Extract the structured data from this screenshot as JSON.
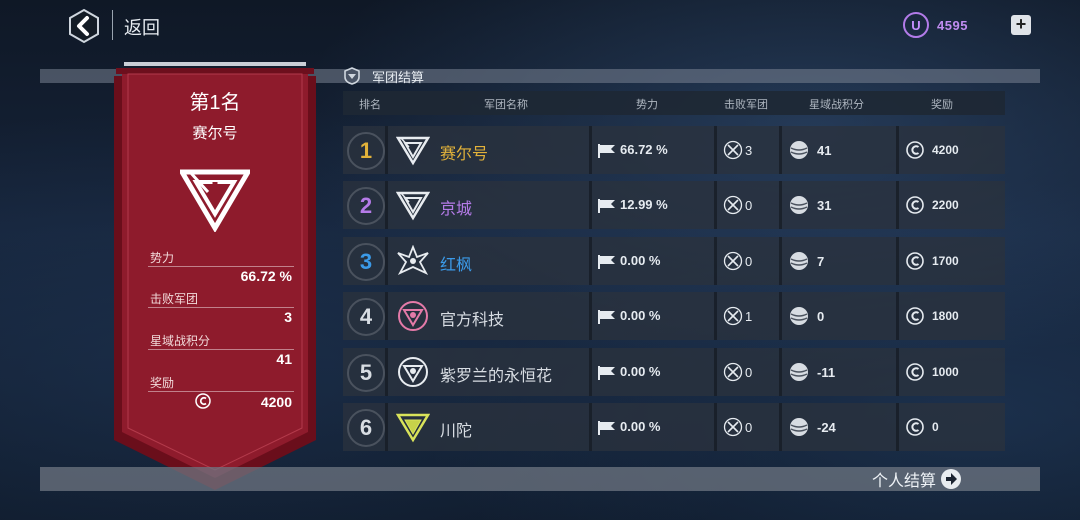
{
  "header": {
    "back_label": "返回",
    "currency": {
      "icon": "u-currency-icon",
      "symbol": "U",
      "value": "4595",
      "color": "#c08cf0"
    },
    "plus_label": "+"
  },
  "banner": {
    "rank_title": "第1名",
    "team_name": "赛尔号",
    "color": "#8e1b2c",
    "stats": [
      {
        "label": "势力",
        "value": "66.72 %"
      },
      {
        "label": "击败军团",
        "value": "3"
      },
      {
        "label": "星域战积分",
        "value": "41"
      },
      {
        "label": "奖励",
        "value": "4200",
        "icon": "coin-icon"
      }
    ]
  },
  "section": {
    "title": "军团结算",
    "headers": [
      "排名",
      "军团名称",
      "势力",
      "击败军团",
      "星域战积分",
      "奖励"
    ]
  },
  "rows": [
    {
      "rank": "1",
      "name": "赛尔号",
      "power": "66.72 %",
      "defeated": "3",
      "score": "41",
      "reward": "4200",
      "rank_color": "#e2b23a",
      "name_color": "#e2b23a"
    },
    {
      "rank": "2",
      "name": "京城",
      "power": "12.99 %",
      "defeated": "0",
      "score": "31",
      "reward": "2200",
      "rank_color": "#b57be8",
      "name_color": "#b57be8"
    },
    {
      "rank": "3",
      "name": "红枫",
      "power": "0.00 %",
      "defeated": "0",
      "score": "7",
      "reward": "1700",
      "rank_color": "#3b9ae8",
      "name_color": "#3b9ae8"
    },
    {
      "rank": "4",
      "name": "官方科技",
      "power": "0.00 %",
      "defeated": "1",
      "score": "0",
      "reward": "1800",
      "rank_color": "#d8dde3",
      "name_color": "#d8dde3"
    },
    {
      "rank": "5",
      "name": "紫罗兰的永恒花",
      "power": "0.00 %",
      "defeated": "0",
      "score": "-11",
      "reward": "1000",
      "rank_color": "#d8dde3",
      "name_color": "#d8dde3"
    },
    {
      "rank": "6",
      "name": "川陀",
      "power": "0.00 %",
      "defeated": "0",
      "score": "-24",
      "reward": "0",
      "rank_color": "#d8dde3",
      "name_color": "#d8dde3"
    }
  ],
  "footer": {
    "personal_label": "个人结算"
  }
}
